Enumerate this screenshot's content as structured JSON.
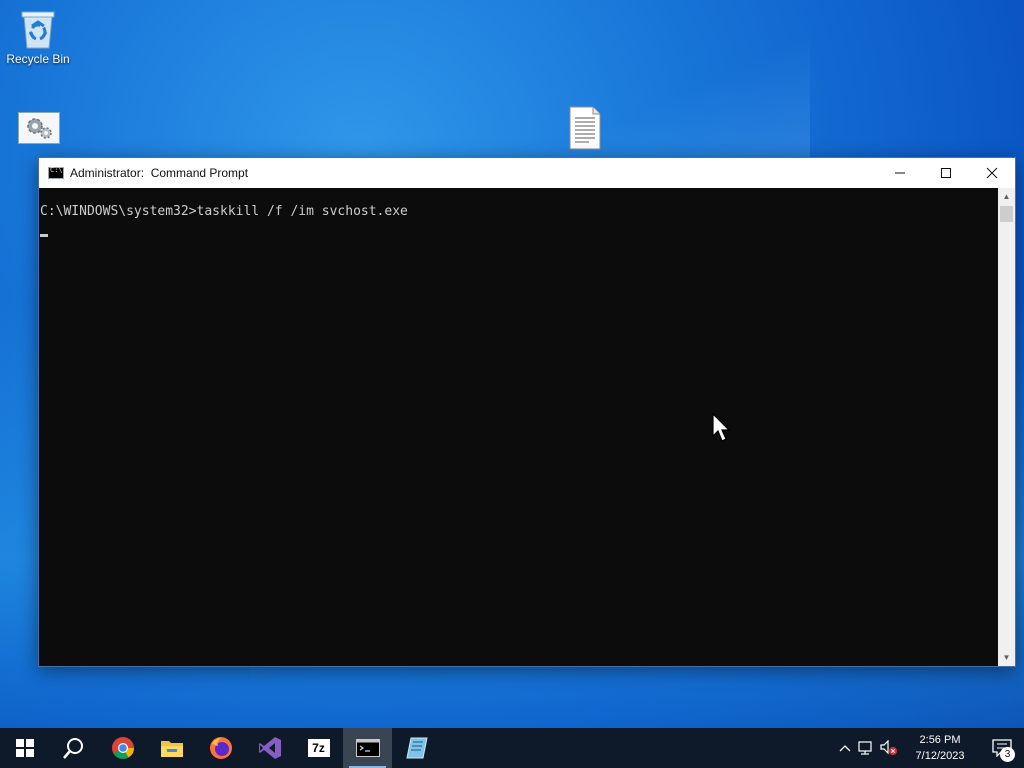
{
  "desktop": {
    "icons": [
      {
        "label": "Recycle Bin",
        "icon": "recycle-bin-icon"
      },
      {
        "label": "",
        "icon": "settings-shortcut-icon"
      },
      {
        "label": "",
        "icon": "text-document-icon"
      }
    ]
  },
  "window": {
    "title": "Administrator:  Command Prompt",
    "controls": {
      "minimize": "—",
      "maximize": "☐",
      "close": "✕"
    },
    "console_lines": [
      "C:\\WINDOWS\\system32>taskkill /f /im svchost.exe"
    ],
    "scroll_up": "▲",
    "scroll_down": "▼"
  },
  "taskbar": {
    "apps": [
      {
        "name": "start",
        "icon": "windows-start-icon"
      },
      {
        "name": "search",
        "icon": "search-icon"
      },
      {
        "name": "chrome",
        "icon": "chrome-icon"
      },
      {
        "name": "file-explorer",
        "icon": "folder-icon"
      },
      {
        "name": "firefox",
        "icon": "firefox-icon"
      },
      {
        "name": "visual-studio",
        "icon": "visual-studio-icon"
      },
      {
        "name": "7zip",
        "icon": "7zip-icon",
        "label": "7z"
      },
      {
        "name": "command-prompt",
        "icon": "cmd-icon",
        "active": true
      },
      {
        "name": "notepad",
        "icon": "notepad-icon"
      }
    ],
    "tray": {
      "chevron": "^",
      "time": "2:56 PM",
      "date": "7/12/2023",
      "notification_count": "3"
    }
  },
  "colors": {
    "taskbar_bg": "#0e1a29",
    "console_bg": "#0c0c0c",
    "console_fg": "#cccccc",
    "accent": "#8bb8e8"
  }
}
